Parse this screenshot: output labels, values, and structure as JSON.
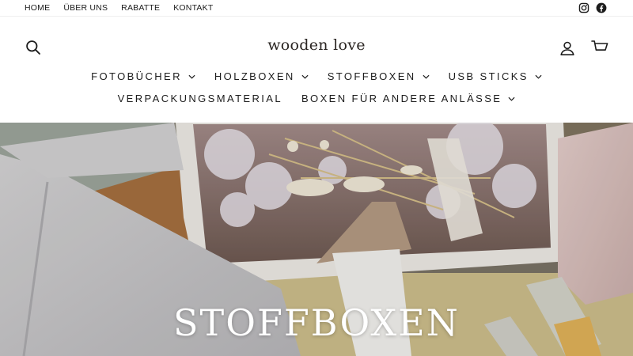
{
  "topbar": {
    "links": [
      "HOME",
      "ÜBER UNS",
      "RABATTE",
      "KONTAKT"
    ],
    "social": [
      {
        "icon": "instagram-icon"
      },
      {
        "icon": "facebook-icon"
      }
    ]
  },
  "header": {
    "logo_text": "wooden love",
    "icons": {
      "search": "search-icon",
      "account": "account-icon",
      "cart": "cart-icon"
    }
  },
  "nav": {
    "row1": [
      {
        "label": "FOTOBÜCHER",
        "has_dropdown": true
      },
      {
        "label": "HOLZBOXEN",
        "has_dropdown": true
      },
      {
        "label": "STOFFBOXEN",
        "has_dropdown": true
      },
      {
        "label": "USB STICKS",
        "has_dropdown": true
      }
    ],
    "row2": [
      {
        "label": "VERPACKUNGSMATERIAL",
        "has_dropdown": false
      },
      {
        "label": "BOXEN FÜR ANDERE ANLÄSSE",
        "has_dropdown": true
      }
    ]
  },
  "hero": {
    "title": "STOFFBOXEN"
  },
  "colors": {
    "text": "#1c1c1c",
    "background": "#ffffff",
    "hero_title": "#ffffff"
  }
}
